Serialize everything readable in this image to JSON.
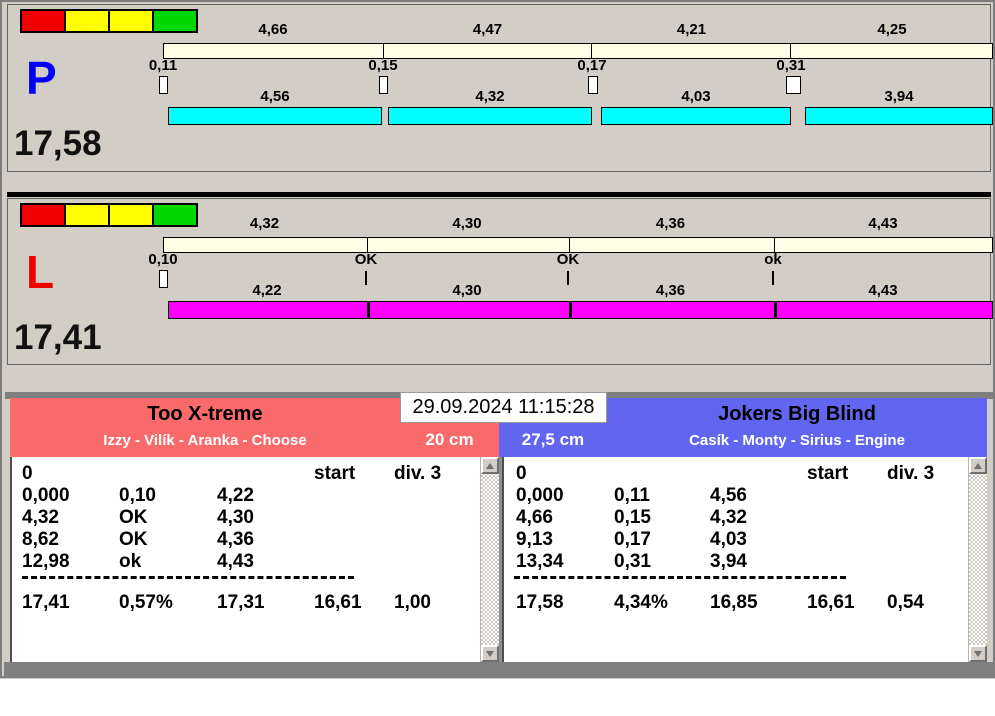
{
  "datetime": "29.09.2024 11:15:28",
  "colors": {
    "panel_bg": "#d2cec6",
    "split_bar": "#fffee6",
    "lane_p_bar": "#00ffff",
    "lane_l_bar": "#ff00ff",
    "lane_p_letter": "#0000f5",
    "lane_l_letter": "#f00000",
    "team_left_accent": "#f96a6a",
    "team_right_accent": "#6265ef",
    "light_red": "#f00000",
    "light_yellow": "#ffff00",
    "light_green": "#00d800"
  },
  "lanes": [
    {
      "letter": "P",
      "total": "17,58",
      "splits": [
        "4,66",
        "4,47",
        "4,21",
        "4,25"
      ],
      "markers": [
        "0,11",
        "0,15",
        "0,17",
        "0,31"
      ],
      "runs": [
        "4,56",
        "4,32",
        "4,03",
        "3,94"
      ]
    },
    {
      "letter": "L",
      "total": "17,41",
      "splits": [
        "4,32",
        "4,30",
        "4,36",
        "4,43"
      ],
      "markers": [
        "0,10",
        "OK",
        "OK",
        "ok"
      ],
      "runs": [
        "4,22",
        "4,30",
        "4,36",
        "4,43"
      ]
    }
  ],
  "teams": [
    {
      "name": "Too X-treme",
      "dogs": "Izzy - Vilík - Aranka - Choose",
      "height": "20 cm",
      "table": {
        "col_start": "start",
        "col_div": "div. 3",
        "first": "0",
        "rows": [
          [
            "0,000",
            "0,10",
            "4,22"
          ],
          [
            "4,32",
            "OK",
            "4,30"
          ],
          [
            "8,62",
            "OK",
            "4,36"
          ],
          [
            "12,98",
            "ok",
            "4,43"
          ]
        ],
        "totals": [
          "17,41",
          "0,57%",
          "17,31",
          "16,61",
          "1,00"
        ]
      }
    },
    {
      "name": "Jokers Big Blind",
      "dogs": "Casík - Monty - Sirius - Engine",
      "height": "27,5 cm",
      "table": {
        "col_start": "start",
        "col_div": "div. 3",
        "first": "0",
        "rows": [
          [
            "0,000",
            "0,11",
            "4,56"
          ],
          [
            "4,66",
            "0,15",
            "4,32"
          ],
          [
            "9,13",
            "0,17",
            "4,03"
          ],
          [
            "13,34",
            "0,31",
            "3,94"
          ]
        ],
        "totals": [
          "17,58",
          "4,34%",
          "16,85",
          "16,61",
          "0,54"
        ]
      }
    }
  ]
}
